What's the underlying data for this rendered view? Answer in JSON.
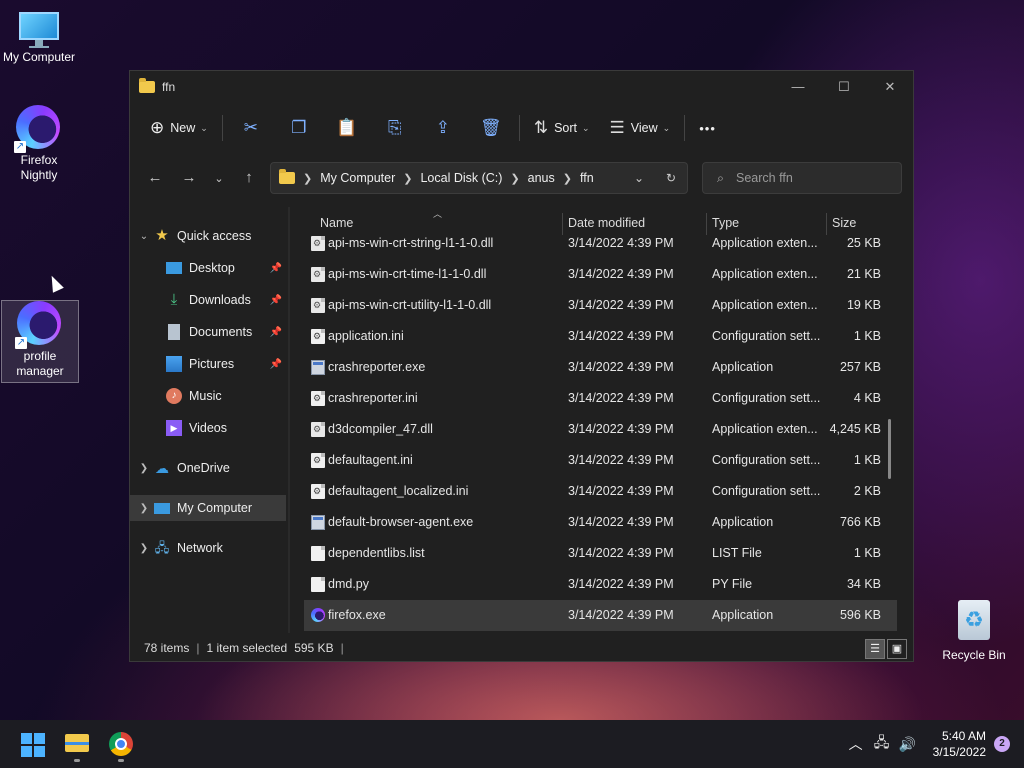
{
  "desktop": {
    "icons": [
      {
        "label": "My Computer"
      },
      {
        "label": "Firefox Nightly"
      },
      {
        "label": "profile manager"
      },
      {
        "label": "Recycle Bin"
      }
    ]
  },
  "window": {
    "title": "ffn",
    "controls": {
      "minimize": "—",
      "maximize": "☐",
      "close": "✕"
    },
    "toolbar": {
      "new_label": "New",
      "sort_label": "Sort",
      "view_label": "View",
      "more": "•••"
    },
    "address": {
      "crumbs": [
        "My Computer",
        "Local Disk (C:)",
        "anus",
        "ffn"
      ]
    },
    "search": {
      "placeholder": "Search ffn"
    },
    "sidebar": {
      "quick_access": "Quick access",
      "items": [
        "Desktop",
        "Downloads",
        "Documents",
        "Pictures",
        "Music",
        "Videos"
      ],
      "onedrive": "OneDrive",
      "my_computer": "My Computer",
      "network": "Network"
    },
    "columns": {
      "name": "Name",
      "date": "Date modified",
      "type": "Type",
      "size": "Size"
    },
    "files": [
      {
        "name": "api-ms-win-crt-string-l1-1-0.dll",
        "date": "3/14/2022 4:39 PM",
        "type": "Application exten...",
        "size": "25 KB",
        "icon": "dll"
      },
      {
        "name": "api-ms-win-crt-time-l1-1-0.dll",
        "date": "3/14/2022 4:39 PM",
        "type": "Application exten...",
        "size": "21 KB",
        "icon": "dll"
      },
      {
        "name": "api-ms-win-crt-utility-l1-1-0.dll",
        "date": "3/14/2022 4:39 PM",
        "type": "Application exten...",
        "size": "19 KB",
        "icon": "dll"
      },
      {
        "name": "application.ini",
        "date": "3/14/2022 4:39 PM",
        "type": "Configuration sett...",
        "size": "1 KB",
        "icon": "ini"
      },
      {
        "name": "crashreporter.exe",
        "date": "3/14/2022 4:39 PM",
        "type": "Application",
        "size": "257 KB",
        "icon": "exe"
      },
      {
        "name": "crashreporter.ini",
        "date": "3/14/2022 4:39 PM",
        "type": "Configuration sett...",
        "size": "4 KB",
        "icon": "ini"
      },
      {
        "name": "d3dcompiler_47.dll",
        "date": "3/14/2022 4:39 PM",
        "type": "Application exten...",
        "size": "4,245 KB",
        "icon": "dll"
      },
      {
        "name": "defaultagent.ini",
        "date": "3/14/2022 4:39 PM",
        "type": "Configuration sett...",
        "size": "1 KB",
        "icon": "ini"
      },
      {
        "name": "defaultagent_localized.ini",
        "date": "3/14/2022 4:39 PM",
        "type": "Configuration sett...",
        "size": "2 KB",
        "icon": "ini"
      },
      {
        "name": "default-browser-agent.exe",
        "date": "3/14/2022 4:39 PM",
        "type": "Application",
        "size": "766 KB",
        "icon": "exe"
      },
      {
        "name": "dependentlibs.list",
        "date": "3/14/2022 4:39 PM",
        "type": "LIST File",
        "size": "1 KB",
        "icon": "file"
      },
      {
        "name": "dmd.py",
        "date": "3/14/2022 4:39 PM",
        "type": "PY File",
        "size": "34 KB",
        "icon": "file"
      },
      {
        "name": "firefox.exe",
        "date": "3/14/2022 4:39 PM",
        "type": "Application",
        "size": "596 KB",
        "icon": "firefox",
        "selected": true
      }
    ],
    "status": {
      "count": "78 items",
      "selected": "1 item selected",
      "size": "595 KB"
    }
  },
  "taskbar": {
    "time": "5:40 AM",
    "date": "3/15/2022",
    "notifications": "2"
  },
  "colors": {
    "accent": "#4cb3ff",
    "window_bg": "#202020",
    "selection": "#3a3a3a"
  }
}
